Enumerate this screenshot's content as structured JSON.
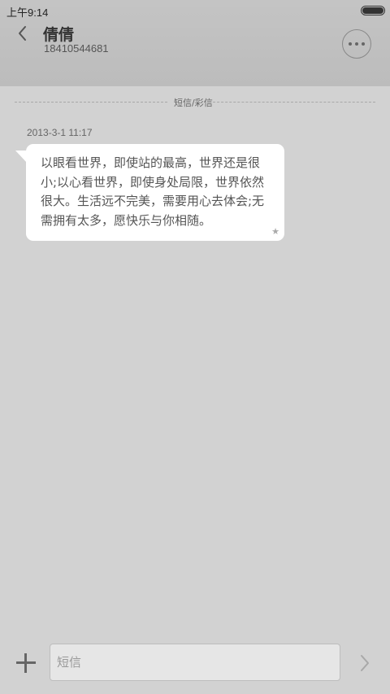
{
  "status_bar": {
    "time": "上午9:14"
  },
  "header": {
    "contact_name": "倩倩",
    "contact_number": "18410544681"
  },
  "thread": {
    "divider_label": "短信/彩信",
    "messages": [
      {
        "timestamp": "2013-3-1 11:17",
        "text": "以眼看世界，即使站的最高，世界还是很小;以心看世界，即使身处局限，世界依然很大。生活远不完美，需要用心去体会;无需拥有太多，愿快乐与你相随。",
        "starred": true
      }
    ]
  },
  "composer": {
    "placeholder": "短信"
  },
  "icons": {
    "back": "chevron-left-icon",
    "more": "more-horizontal-icon",
    "star": "star-icon",
    "add": "plus-icon",
    "send": "chevron-right-icon",
    "battery": "battery-icon"
  }
}
